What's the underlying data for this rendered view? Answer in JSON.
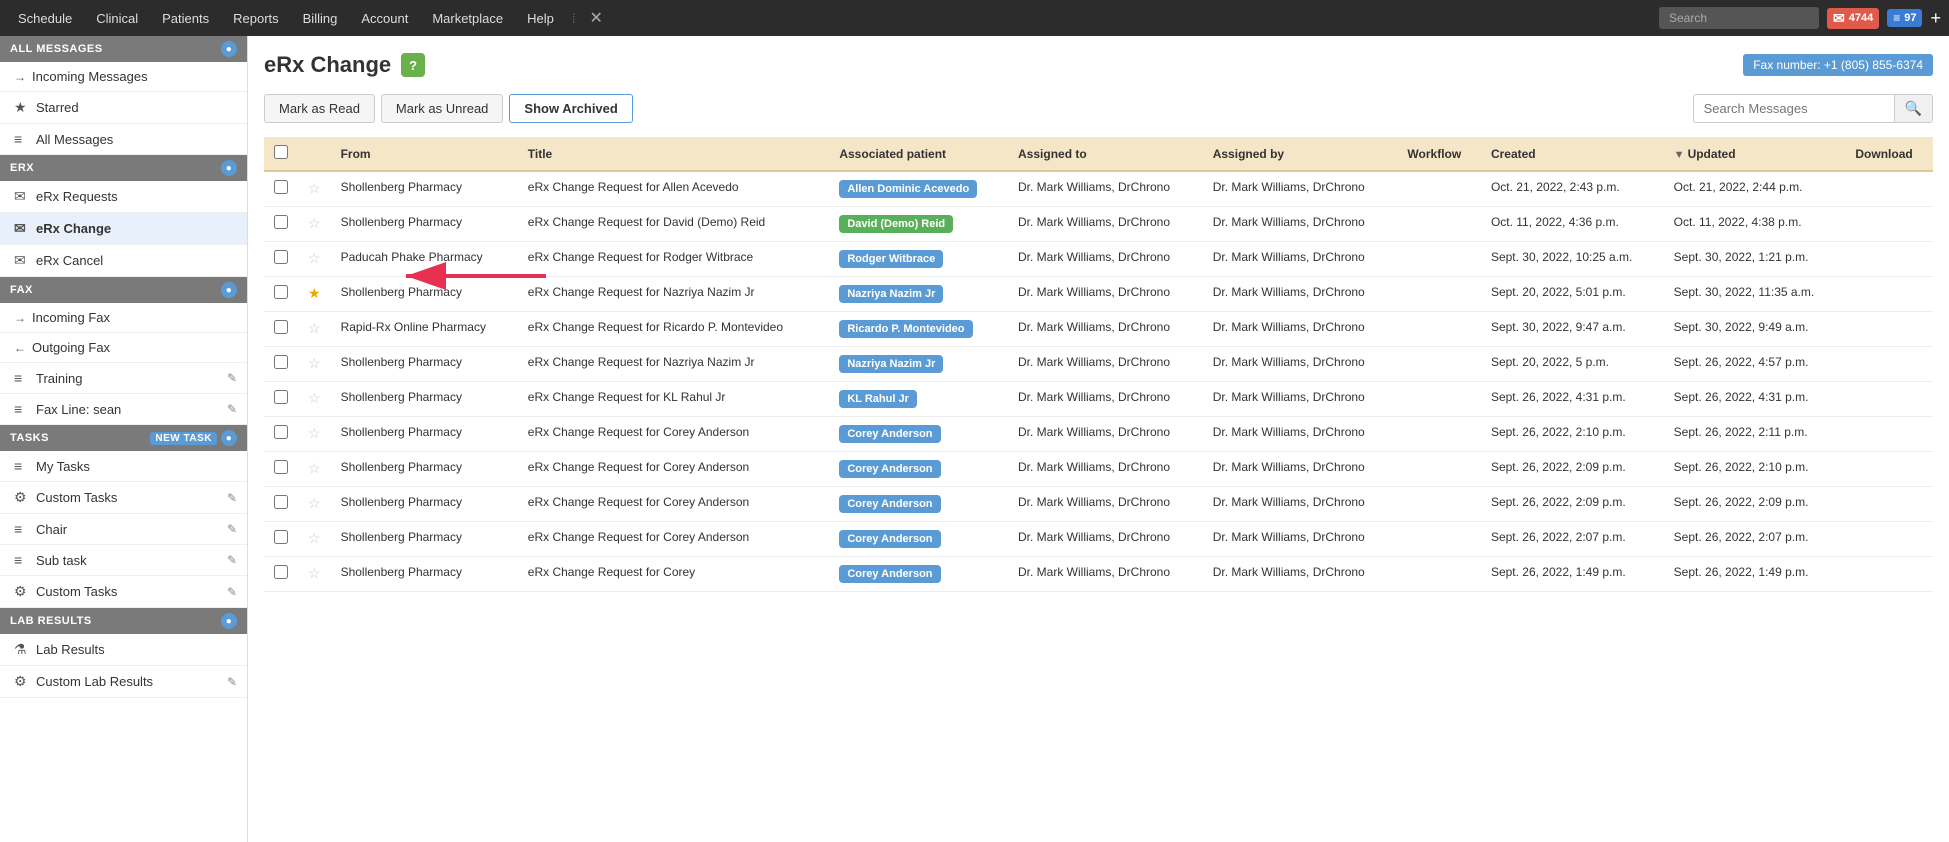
{
  "topNav": {
    "items": [
      "Schedule",
      "Clinical",
      "Patients",
      "Reports",
      "Billing",
      "Account",
      "Marketplace",
      "Help"
    ],
    "searchPlaceholder": "Search",
    "badge1": "4744",
    "badge2": "97"
  },
  "sidebar": {
    "allMessages": {
      "header": "ALL MESSAGES",
      "items": [
        {
          "label": "Incoming Messages",
          "icon": "→",
          "type": "arrow"
        },
        {
          "label": "Starred",
          "icon": "★",
          "type": "star"
        },
        {
          "label": "All Messages",
          "icon": "≡",
          "type": "list"
        }
      ]
    },
    "erx": {
      "header": "ERX",
      "items": [
        {
          "label": "eRx Requests",
          "icon": "✉",
          "type": "msg"
        },
        {
          "label": "eRx Change",
          "icon": "✉",
          "type": "msg",
          "active": true
        },
        {
          "label": "eRx Cancel",
          "icon": "✉",
          "type": "msg"
        }
      ]
    },
    "fax": {
      "header": "FAX",
      "items": [
        {
          "label": "Incoming Fax",
          "icon": "→",
          "type": "arrow"
        },
        {
          "label": "Outgoing Fax",
          "icon": "←",
          "type": "arrow"
        },
        {
          "label": "Training",
          "icon": "≡",
          "type": "list",
          "editable": true
        },
        {
          "label": "Fax Line: sean",
          "icon": "≡",
          "type": "list",
          "editable": true
        }
      ]
    },
    "tasks": {
      "header": "TASKS",
      "newTask": "NEW TASK",
      "items": [
        {
          "label": "My Tasks",
          "icon": "≡",
          "type": "list"
        },
        {
          "label": "Custom Tasks",
          "icon": "⚙",
          "type": "gear",
          "editable": true
        },
        {
          "label": "Chair",
          "icon": "≡",
          "type": "list",
          "editable": true
        },
        {
          "label": "Sub task",
          "icon": "≡",
          "type": "list",
          "editable": true
        },
        {
          "label": "Custom Tasks",
          "icon": "⚙",
          "type": "gear",
          "editable": true
        }
      ]
    },
    "labResults": {
      "header": "LAB RESULTS",
      "items": [
        {
          "label": "Lab Results",
          "icon": "⚗",
          "type": "lab"
        },
        {
          "label": "Custom Lab Results",
          "icon": "⚙",
          "type": "gear",
          "editable": true
        }
      ]
    }
  },
  "main": {
    "title": "eRx Change",
    "faxNumber": "Fax number: +1 (805) 855-6374",
    "buttons": {
      "markRead": "Mark as Read",
      "markUnread": "Mark as Unread",
      "showArchived": "Show Archived"
    },
    "searchPlaceholder": "Search Messages",
    "tableHeaders": [
      "",
      "",
      "From",
      "Title",
      "Associated patient",
      "Assigned to",
      "Assigned by",
      "Workflow",
      "Created",
      "Updated",
      "Download"
    ],
    "rows": [
      {
        "from": "Shollenberg Pharmacy",
        "title": "eRx Change Request for Allen Acevedo",
        "patient": "Allen Dominic Acevedo",
        "patientColor": "blue",
        "assignedTo": "Dr. Mark Williams, DrChrono",
        "assignedBy": "Dr. Mark Williams, DrChrono",
        "workflow": "",
        "created": "Oct. 21, 2022, 2:43 p.m.",
        "updated": "Oct. 21, 2022, 2:44 p.m.",
        "starred": false
      },
      {
        "from": "Shollenberg Pharmacy",
        "title": "eRx Change Request for David (Demo) Reid",
        "patient": "David (Demo) Reid",
        "patientColor": "green",
        "assignedTo": "Dr. Mark Williams, DrChrono",
        "assignedBy": "Dr. Mark Williams, DrChrono",
        "workflow": "",
        "created": "Oct. 11, 2022, 4:36 p.m.",
        "updated": "Oct. 11, 2022, 4:38 p.m.",
        "starred": false
      },
      {
        "from": "Paducah Phake Pharmacy",
        "title": "eRx Change Request for Rodger Witbrace",
        "patient": "Rodger Witbrace",
        "patientColor": "blue",
        "assignedTo": "Dr. Mark Williams, DrChrono",
        "assignedBy": "Dr. Mark Williams, DrChrono",
        "workflow": "",
        "created": "Sept. 30, 2022, 10:25 a.m.",
        "updated": "Sept. 30, 2022, 1:21 p.m.",
        "starred": false
      },
      {
        "from": "Shollenberg Pharmacy",
        "title": "eRx Change Request for Nazriya Nazim Jr",
        "patient": "Nazriya Nazim Jr",
        "patientColor": "blue",
        "assignedTo": "Dr. Mark Williams, DrChrono",
        "assignedBy": "Dr. Mark Williams, DrChrono",
        "workflow": "",
        "created": "Sept. 20, 2022, 5:01 p.m.",
        "updated": "Sept. 30, 2022, 11:35 a.m.",
        "starred": true
      },
      {
        "from": "Rapid-Rx Online Pharmacy",
        "title": "eRx Change Request for Ricardo P. Montevideo",
        "patient": "Ricardo P. Montevideo",
        "patientColor": "blue",
        "assignedTo": "Dr. Mark Williams, DrChrono",
        "assignedBy": "Dr. Mark Williams, DrChrono",
        "workflow": "",
        "created": "Sept. 30, 2022, 9:47 a.m.",
        "updated": "Sept. 30, 2022, 9:49 a.m.",
        "starred": false
      },
      {
        "from": "Shollenberg Pharmacy",
        "title": "eRx Change Request for Nazriya Nazim Jr",
        "patient": "Nazriya Nazim Jr",
        "patientColor": "blue",
        "assignedTo": "Dr. Mark Williams, DrChrono",
        "assignedBy": "Dr. Mark Williams, DrChrono",
        "workflow": "",
        "created": "Sept. 20, 2022, 5 p.m.",
        "updated": "Sept. 26, 2022, 4:57 p.m.",
        "starred": false
      },
      {
        "from": "Shollenberg Pharmacy",
        "title": "eRx Change Request for KL Rahul Jr",
        "patient": "KL Rahul Jr",
        "patientColor": "blue",
        "assignedTo": "Dr. Mark Williams, DrChrono",
        "assignedBy": "Dr. Mark Williams, DrChrono",
        "workflow": "",
        "created": "Sept. 26, 2022, 4:31 p.m.",
        "updated": "Sept. 26, 2022, 4:31 p.m.",
        "starred": false
      },
      {
        "from": "Shollenberg Pharmacy",
        "title": "eRx Change Request for Corey Anderson",
        "patient": "Corey Anderson",
        "patientColor": "blue",
        "assignedTo": "Dr. Mark Williams, DrChrono",
        "assignedBy": "Dr. Mark Williams, DrChrono",
        "workflow": "",
        "created": "Sept. 26, 2022, 2:10 p.m.",
        "updated": "Sept. 26, 2022, 2:11 p.m.",
        "starred": false
      },
      {
        "from": "Shollenberg Pharmacy",
        "title": "eRx Change Request for Corey Anderson",
        "patient": "Corey Anderson",
        "patientColor": "blue",
        "assignedTo": "Dr. Mark Williams, DrChrono",
        "assignedBy": "Dr. Mark Williams, DrChrono",
        "workflow": "",
        "created": "Sept. 26, 2022, 2:09 p.m.",
        "updated": "Sept. 26, 2022, 2:10 p.m.",
        "starred": false
      },
      {
        "from": "Shollenberg Pharmacy",
        "title": "eRx Change Request for Corey Anderson",
        "patient": "Corey Anderson",
        "patientColor": "blue",
        "assignedTo": "Dr. Mark Williams, DrChrono",
        "assignedBy": "Dr. Mark Williams, DrChrono",
        "workflow": "",
        "created": "Sept. 26, 2022, 2:09 p.m.",
        "updated": "Sept. 26, 2022, 2:09 p.m.",
        "starred": false
      },
      {
        "from": "Shollenberg Pharmacy",
        "title": "eRx Change Request for Corey Anderson",
        "patient": "Corey Anderson",
        "patientColor": "blue",
        "assignedTo": "Dr. Mark Williams, DrChrono",
        "assignedBy": "Dr. Mark Williams, DrChrono",
        "workflow": "",
        "created": "Sept. 26, 2022, 2:07 p.m.",
        "updated": "Sept. 26, 2022, 2:07 p.m.",
        "starred": false
      },
      {
        "from": "Shollenberg Pharmacy",
        "title": "eRx Change Request for Corey",
        "patient": "Corey Anderson",
        "patientColor": "blue",
        "assignedTo": "Dr. Mark Williams, DrChrono",
        "assignedBy": "Dr. Mark Williams, DrChrono",
        "workflow": "",
        "created": "Sept. 26, 2022, 1:49 p.m.",
        "updated": "Sept. 26, 2022, 1:49 p.m.",
        "starred": false
      }
    ]
  }
}
